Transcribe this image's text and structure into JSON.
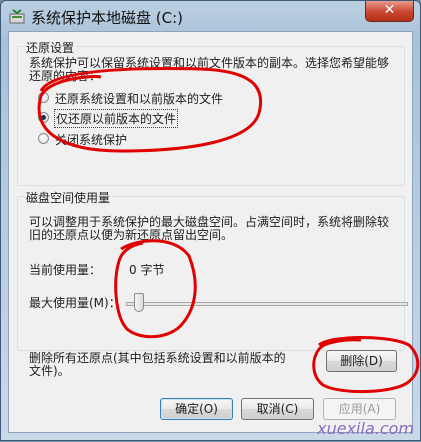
{
  "window": {
    "title": "系统保护本地磁盘 (C:)",
    "close_label": "✕"
  },
  "restore_settings": {
    "group_title": "还原设置",
    "description_line1": "系统保护可以保留系统设置和以前文件版本的副本。选择您希望能够",
    "description_line2": "还原的内容：",
    "options": [
      {
        "label": "还原系统设置和以前版本的文件",
        "checked": false
      },
      {
        "label": "仅还原以前版本的文件",
        "checked": true
      },
      {
        "label": "关闭系统保护",
        "checked": false
      }
    ]
  },
  "disk_usage": {
    "group_title": "磁盘空间使用量",
    "description_line1": "可以调整用于系统保护的最大磁盘空间。占满空间时，系统将删除较",
    "description_line2": "旧的还原点以便为新还原点留出空间。",
    "current_label": "当前使用量：",
    "current_value": "0 字节",
    "max_label": "最大使用量(M)：",
    "slider_percent": 0
  },
  "delete_section": {
    "text_line1": "删除所有还原点(其中包括系统设置和以前版本的",
    "text_line2": "文件)。",
    "button_label": "删除(D)"
  },
  "footer": {
    "ok_label": "确定(O)",
    "cancel_label": "取消(C)",
    "apply_label": "应用(A)"
  },
  "watermark": "xuexila.com",
  "colors": {
    "annotation_red": "#e00000",
    "watermark": "#8c6cc2"
  }
}
